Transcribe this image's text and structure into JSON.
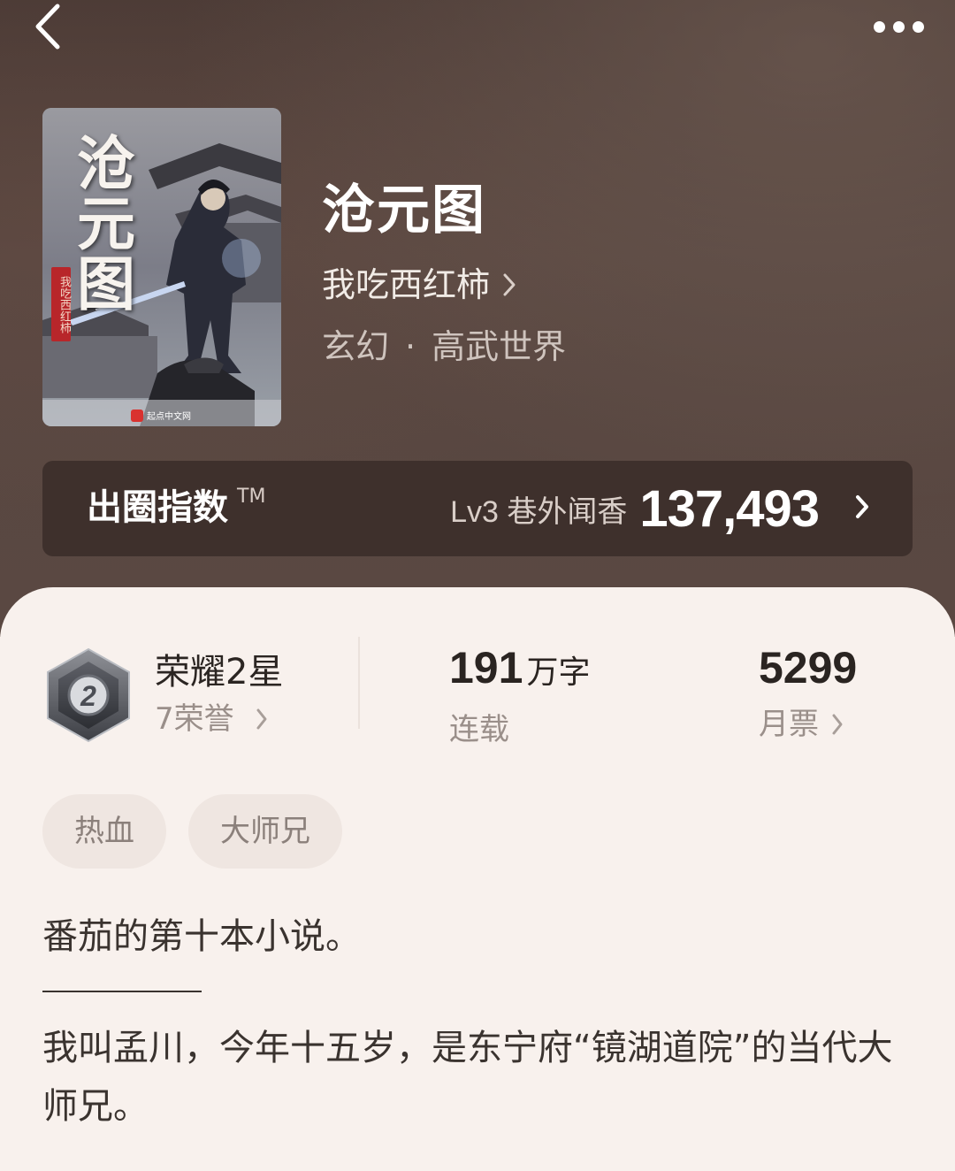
{
  "book": {
    "title": "沧元图",
    "author": "我吃西红柿",
    "genre_main": "玄幻",
    "genre_sep": "·",
    "genre_sub": "高武世界",
    "cover": {
      "title": "沧元图",
      "author_seal": "我吃西红柿",
      "publisher": "起点中文网"
    }
  },
  "index": {
    "label": "出圈指数",
    "tm": "TM",
    "level": "Lv3 巷外闻香",
    "value": "137,493"
  },
  "stats": {
    "honor_title": "荣耀2星",
    "honor_badge_number": "2",
    "honor_sub": "7荣誉",
    "word_count": "191",
    "word_unit": "万字",
    "status": "连载",
    "monthly_votes": "5299",
    "votes_label": "月票"
  },
  "tags": [
    "热血",
    "大师兄"
  ],
  "synopsis": {
    "line1": "番茄的第十本小说。",
    "line2": "我叫孟川，今年十五岁，是东宁府“镜湖道院”的当代大师兄。"
  },
  "icons": {
    "back": "chevron-left-icon",
    "more": "more-dots-icon",
    "chevron": "chevron-right-icon"
  },
  "colors": {
    "hero_bg": "#574640",
    "card_bg": "#f8f1ed",
    "tag_bg": "#efe6e1",
    "text_dark": "#2a2421",
    "text_muted": "#9a8f8a"
  }
}
